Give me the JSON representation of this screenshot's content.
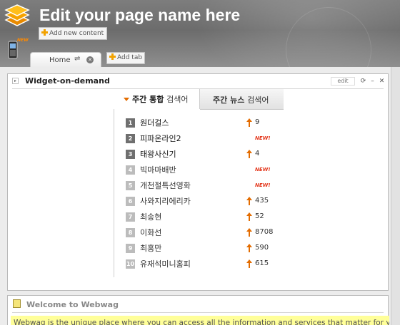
{
  "header": {
    "title": "Edit your page name here",
    "new_badge": "NEW",
    "add_content_label": "Add new content"
  },
  "tabs": {
    "home_label": "Home",
    "add_tab_label": "Add tab"
  },
  "widget": {
    "title": "Widget-on-demand",
    "edit_label": "edit",
    "tab1_bold": "주간 통합",
    "tab1_light": "검색어",
    "tab2_bold": "주간 뉴스",
    "tab2_light": "검색어",
    "items": [
      {
        "rank": "1",
        "word": "원더걸스",
        "trend": "up",
        "value": "9"
      },
      {
        "rank": "2",
        "word": "피파온라인2",
        "trend": "new",
        "value": "NEW!"
      },
      {
        "rank": "3",
        "word": "태왕사신기",
        "trend": "up",
        "value": "4"
      },
      {
        "rank": "4",
        "word": "빅마마배반",
        "trend": "new",
        "value": "NEW!"
      },
      {
        "rank": "5",
        "word": "개천절특선영화",
        "trend": "new",
        "value": "NEW!"
      },
      {
        "rank": "6",
        "word": "사와지리에리카",
        "trend": "up",
        "value": "435"
      },
      {
        "rank": "7",
        "word": "최송현",
        "trend": "up",
        "value": "52"
      },
      {
        "rank": "8",
        "word": "이화선",
        "trend": "up",
        "value": "8708"
      },
      {
        "rank": "9",
        "word": "최홍만",
        "trend": "up",
        "value": "590"
      },
      {
        "rank": "10",
        "word": "유재석미니홈피",
        "trend": "up",
        "value": "615"
      }
    ]
  },
  "welcome": {
    "title": "Welcome to Webwag",
    "text": "Webwag is the unique place where you can access all the information and services that matter for you, in"
  },
  "colors": {
    "accent_orange": "#e36c00",
    "rank_top": "#6f6f6f",
    "rank_other": "#bcbcbc",
    "new_red": "#e4371c",
    "highlight_yellow": "#ffff99"
  }
}
